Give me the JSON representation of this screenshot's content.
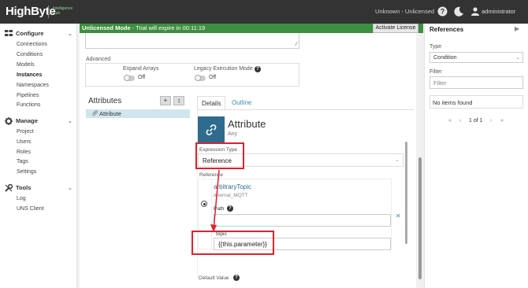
{
  "topbar": {
    "logo": "HighByte",
    "logo_sub_line1": "Intelligence",
    "logo_sub_line2": "Hub",
    "license_status": "Unknown - Unlicensed",
    "user": "administrator"
  },
  "sidebar": {
    "configure": {
      "label": "Configure",
      "items": [
        "Connections",
        "Conditions",
        "Models",
        "Instances",
        "Namespaces",
        "Pipelines",
        "Functions"
      ]
    },
    "manage": {
      "label": "Manage",
      "items": [
        "Project",
        "Users",
        "Roles",
        "Tags",
        "Settings"
      ]
    },
    "tools": {
      "label": "Tools",
      "items": [
        "Log",
        "UNS Client"
      ]
    },
    "active_item": "Instances"
  },
  "banner": {
    "mode": "Unlicensed Mode",
    "message": " - Trial will expire in 00:11:19",
    "activate_label": "Activate License",
    "color": "#3e8e41"
  },
  "advanced": {
    "label": "Advanced",
    "expand_arrays_label": "Expand Arrays",
    "expand_arrays_value": "Off",
    "legacy_mode_label": "Legacy Execution Mode",
    "legacy_mode_value": "Off"
  },
  "attributes": {
    "title": "Attributes",
    "add_icon": "+",
    "move_icon": "↕",
    "list": [
      {
        "label": "Attribute"
      }
    ]
  },
  "tabs": [
    {
      "label": "Details",
      "selected": true
    },
    {
      "label": "Outline",
      "selected": false
    }
  ],
  "detail": {
    "name": "Attribute",
    "type": "Any",
    "expression_type_label": "Expression Type",
    "expression_type_value": "Reference",
    "reference_label": "Reference",
    "ref_topic": "arbitraryTopic",
    "ref_connection": "Internal_MQTT",
    "path_label": "Path",
    "path_value": "",
    "param_label": "topic",
    "param_value": "{{this.parameter}}",
    "default_value_label": "Default Value"
  },
  "right_panel": {
    "title": "References",
    "type_label": "Type",
    "type_value": "Condition",
    "filter_label": "Filter",
    "filter_placeholder": "Filter",
    "empty_message": "No items found",
    "pager": {
      "first": "«",
      "prev": "‹",
      "page": "1 of 1",
      "next": "›",
      "last": "»"
    }
  },
  "annotation_color": "#e0212b",
  "accent_color": "#2e6b8f"
}
